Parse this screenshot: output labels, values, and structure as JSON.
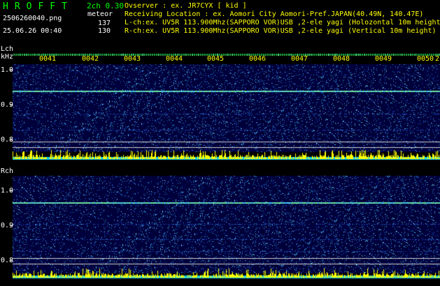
{
  "header": {
    "logo": "HROFFT",
    "version": "2ch 0.30",
    "file_name": "2506260040.png",
    "datetime": "25.06.26 00:40",
    "meteor_label": "meteor",
    "count_lch": "137",
    "count_rch": "130",
    "observer": "Ovserver              : ex. JR7CYX [ kid ]",
    "location": "Receiving Location : ex. Aomori City Aomori-Pref.JAPAN(40.49N, 140.47E)",
    "lch_info": "L-ch:ex. UV5R 113.900Mhz(SAPPORO VOR)USB ,2-ele yagi (Holozontal 10m height)",
    "rch_info": "R-ch:ex. UV5R 113.900Mhz(SAPPORO VOR)USB ,2-ele yagi (Vertical 10m height)"
  },
  "lch": {
    "label": "Lch",
    "unit": "kHz",
    "ticks": [
      "1.0",
      "0.9",
      "0.8"
    ]
  },
  "rch": {
    "label": "Rch",
    "ticks": [
      "1.0",
      "0.9",
      "0.8"
    ]
  },
  "time_labels": [
    "0041",
    "0042",
    "0043",
    "0044",
    "0045",
    "0046",
    "0047",
    "0048",
    "0049",
    "0050",
    "2"
  ],
  "colors": {
    "background": "#000000",
    "noise_base": "#00003a",
    "signal_line": "#7fff7f",
    "activity_bar": "#ffff00",
    "baseline": "#00bfff",
    "guide_line": "#ffffff",
    "header_info": "#ffff00",
    "logo": "#00ff00"
  }
}
